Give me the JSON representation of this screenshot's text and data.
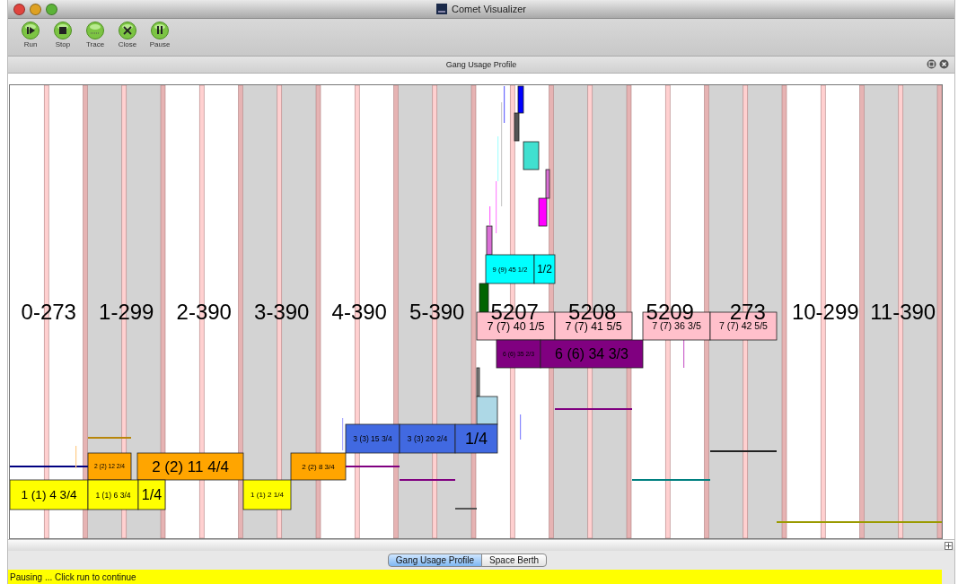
{
  "window": {
    "title": "Comet Visualizer"
  },
  "toolbar": [
    {
      "label": "Run",
      "kind": "run"
    },
    {
      "label": "Stop",
      "kind": "stop"
    },
    {
      "label": "Trace",
      "kind": "trace"
    },
    {
      "label": "Close",
      "kind": "close"
    },
    {
      "label": "Pause",
      "kind": "pause"
    }
  ],
  "panel": {
    "title": "Gang Usage Profile"
  },
  "berths": [
    {
      "label": "0-273"
    },
    {
      "label": "1-299"
    },
    {
      "label": "2-390"
    },
    {
      "label": "3-390"
    },
    {
      "label": "4-390"
    },
    {
      "label": "5-390"
    },
    {
      "label": "5207"
    },
    {
      "label": "5208"
    },
    {
      "label": "5209"
    },
    {
      "label": "273"
    },
    {
      "label": "10-299"
    },
    {
      "label": "11-390"
    }
  ],
  "blocks": [
    {
      "color": "#0000ff"
    },
    {
      "color": "#555555"
    },
    {
      "color": "#40e0d0"
    },
    {
      "color": "#da70d6"
    },
    {
      "color": "#ff00ff"
    },
    {
      "color": "#da70d6"
    },
    {
      "label": "9 (9) 45 1/2",
      "color": "#00ffff"
    },
    {
      "label": "1/2",
      "color": "#00ffff"
    },
    {
      "color": "#006400"
    },
    {
      "label": "7 (7) 40 1/5",
      "color": "#ffc0cb"
    },
    {
      "label": "7 (7) 41 5/5",
      "color": "#ffc0cb"
    },
    {
      "label": "7 (7) 36 3/5",
      "color": "#ffc0cb"
    },
    {
      "label": "7 (7) 42 5/5",
      "color": "#ffc0cb"
    },
    {
      "label": "6 (6) 35 2/3",
      "color": "#800080"
    },
    {
      "label": "6 (6) 34 3/3",
      "color": "#800080"
    },
    {
      "color": "#808080"
    },
    {
      "color": "#add8e6"
    },
    {
      "label": "3 (3) 15 3/4",
      "color": "#4169e1"
    },
    {
      "label": "3 (3) 20 2/4",
      "color": "#4169e1"
    },
    {
      "label": "1/4",
      "color": "#4169e1"
    },
    {
      "label": "2 (2) 12 2/4",
      "color": "#ffa500"
    },
    {
      "label": "2 (2) 11 4/4",
      "color": "#ffa500"
    },
    {
      "label": "2 (2) 8 3/4",
      "color": "#ffa500"
    },
    {
      "label": "1 (1) 4 3/4",
      "color": "#ffff00"
    },
    {
      "label": "1 (1) 6 3/4",
      "color": "#ffff00"
    },
    {
      "label": "1/4",
      "color": "#ffff00"
    },
    {
      "label": "1 (1) 2 1/4",
      "color": "#ffff00"
    }
  ],
  "tabs": [
    {
      "label": "Gang Usage Profile",
      "selected": true
    },
    {
      "label": "Space Berth",
      "selected": false
    }
  ],
  "status_bar": {
    "text": "Pausing ... Click run to continue"
  }
}
